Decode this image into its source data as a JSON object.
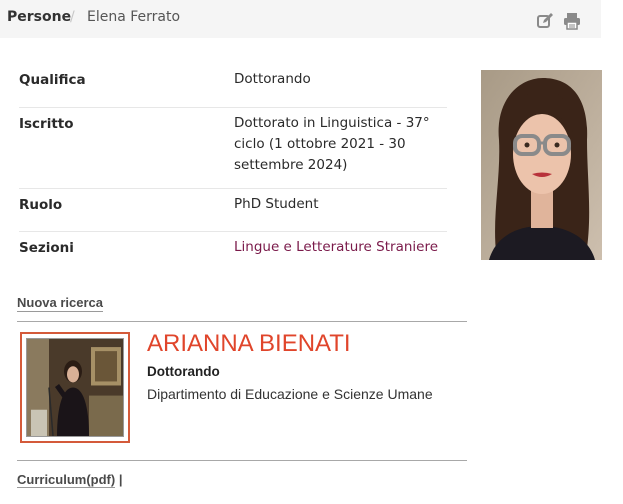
{
  "breadcrumb": {
    "parent": "Persone",
    "separator": "/",
    "current": "Elena Ferrato"
  },
  "toolbar": {
    "edit_icon": "edit-icon",
    "print_icon": "print-icon"
  },
  "profile": {
    "rows": [
      {
        "label": "Qualifica",
        "value": "Dottorando"
      },
      {
        "label": "Iscritto",
        "value": "Dottorato in Linguistica - 37° ciclo (1 ottobre 2021 - 30 settembre 2024)"
      },
      {
        "label": "Ruolo",
        "value": "PhD Student"
      },
      {
        "label": "Sezioni",
        "value": "Lingue e Letterature Straniere"
      }
    ]
  },
  "research": {
    "section_title": "Nuova ricerca",
    "name": "ARIANNA BIENATI",
    "role": "Dottorando",
    "department": "Dipartimento di Educazione e Scienze Umane"
  },
  "footer": {
    "cv_link": "Curriculum(pdf)",
    "cv_separator": "|"
  },
  "colors": {
    "accent_name": "#e0452b",
    "section_link": "#7a1a4a",
    "thumb_border": "#d45a3a",
    "topbar_bg": "#f5f5f5"
  }
}
